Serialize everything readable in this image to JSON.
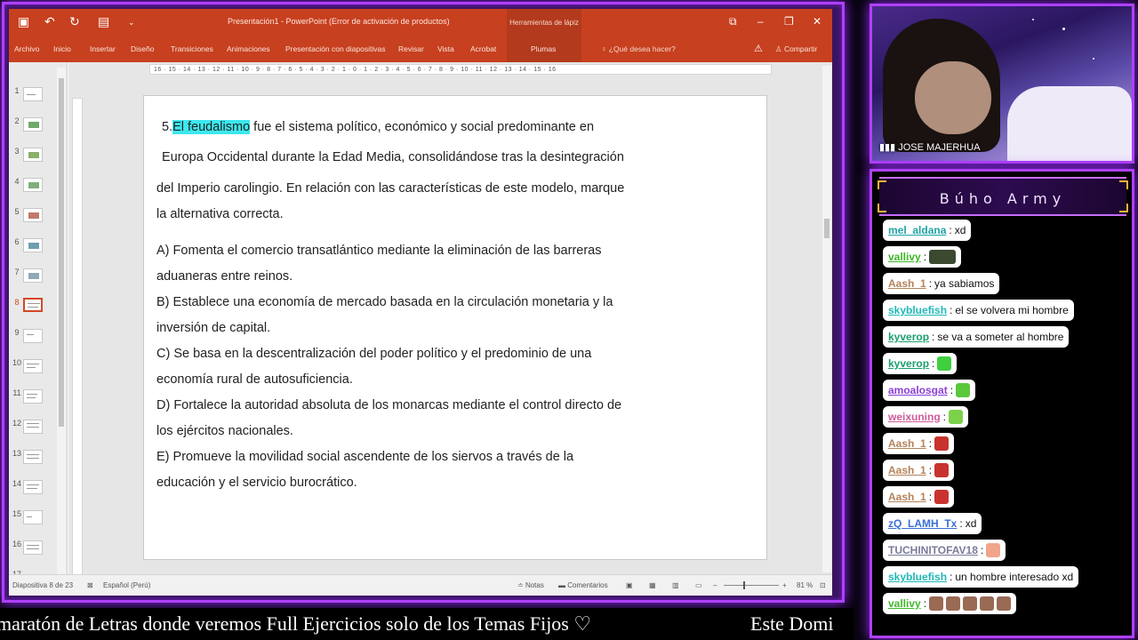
{
  "powerpoint": {
    "window_title": "Presentación1 - PowerPoint (Error de activación de productos)",
    "context_group": "Herramientas de lápiz",
    "tabs": [
      "Archivo",
      "Inicio",
      "Insertar",
      "Diseño",
      "Transiciones",
      "Animaciones",
      "Presentación con diapositivas",
      "Revisar",
      "Vista",
      "Acrobat",
      "Plumas"
    ],
    "search_placeholder": "¿Qué desea hacer?",
    "share_label": "Compartir",
    "ruler_text": "16 · 15 · 14 · 13 · 12 · 11 · 10 · 9 · 8 · 7 · 6 · 5 · 4 · 3 · 2 · 1 · 0 · 1 · 2 · 3 · 4 · 5 · 6 · 7 · 8 · 9 · 10 · 11 · 12 · 13 · 14 · 15 · 16",
    "thumbnail_numbers": [
      "1",
      "2",
      "3",
      "4",
      "5",
      "6",
      "7",
      "8",
      "9",
      "10",
      "11",
      "12",
      "13",
      "14",
      "15",
      "16",
      "17"
    ],
    "selected_slide": 8,
    "slide": {
      "number": "5.",
      "highlight": "El feudalismo",
      "line1_rest": " fue el sistema político, económico y social predominante en",
      "line2": "Europa Occidental durante la Edad Media, consolidándose tras la desintegración",
      "line3": "del Imperio carolingio. En relación con las características de este modelo, marque",
      "line4": "la alternativa correcta.",
      "options": [
        [
          "A) Fomenta el comercio transatlántico mediante la eliminación de las barreras",
          "aduaneras entre reinos."
        ],
        [
          "B) Establece una economía de mercado basada en la circulación monetaria y la",
          "inversión de capital."
        ],
        [
          "C) Se basa en la descentralización del poder político y el predominio de una",
          "economía rural de autosuficiencia."
        ],
        [
          "D) Fortalece la autoridad absoluta de los monarcas mediante el control directo de",
          "los ejércitos nacionales."
        ],
        [
          "E) Promueve la movilidad social ascendente de los siervos a través de la",
          "educación y el servicio burocrático."
        ]
      ]
    },
    "status": {
      "slide_counter": "Diapositiva 8 de 23",
      "language": "Español (Perú)",
      "notes": "Notas",
      "comments": "Comentarios",
      "zoom": "81 %"
    }
  },
  "webcam": {
    "name": "JOSE MAJERHUA"
  },
  "chat": {
    "title": "Búho Army",
    "messages": [
      {
        "user": "mel_aldana",
        "color": "#1fa3a3",
        "text": "xd"
      },
      {
        "user": "vallivy",
        "color": "#3fb82a",
        "emotes": [
          "#3b4a2e"
        ]
      },
      {
        "user": "Aash_1",
        "color": "#b5835a",
        "text": "ya sabiamos"
      },
      {
        "user": "skybluefish",
        "color": "#1fb8b8",
        "text": "el se volvera mi hombre"
      },
      {
        "user": "kyverop",
        "color": "#1a9f6b",
        "text": "se va a someter al hombre"
      },
      {
        "user": "kyverop",
        "color": "#1a9f6b",
        "emotes": [
          "#3fcf3f"
        ]
      },
      {
        "user": "amoalosgat",
        "color": "#8a3fd6",
        "emotes": [
          "#5bc83b"
        ]
      },
      {
        "user": "weixuning",
        "color": "#d05c9a",
        "emotes": [
          "#7bd14a"
        ]
      },
      {
        "user": "Aash_1",
        "color": "#b5835a",
        "emotes": [
          "#c8332e"
        ]
      },
      {
        "user": "Aash_1",
        "color": "#b5835a",
        "emotes": [
          "#c8332e"
        ]
      },
      {
        "user": "Aash_1",
        "color": "#b5835a",
        "emotes": [
          "#c8332e"
        ]
      },
      {
        "user": "zQ_LAMH_Tx",
        "color": "#3b6fd6",
        "text": "xd"
      },
      {
        "user": "TUCHINITOFAV18",
        "color": "#7a7a9a",
        "emotes": [
          "#f0a58a"
        ]
      },
      {
        "user": "skybluefish",
        "color": "#1fb8b8",
        "text": "un hombre interesado xd"
      },
      {
        "user": "vallivy",
        "color": "#3fb82a",
        "emotes": [
          "#9a6a55",
          "#9a6a55",
          "#9a6a55",
          "#9a6a55",
          "#9a6a55"
        ]
      }
    ]
  },
  "ticker": {
    "text": "maratón de Letras donde veremos Full Ejercicios solo de los Temas Fijos ♡",
    "text2": "Este Domi"
  }
}
